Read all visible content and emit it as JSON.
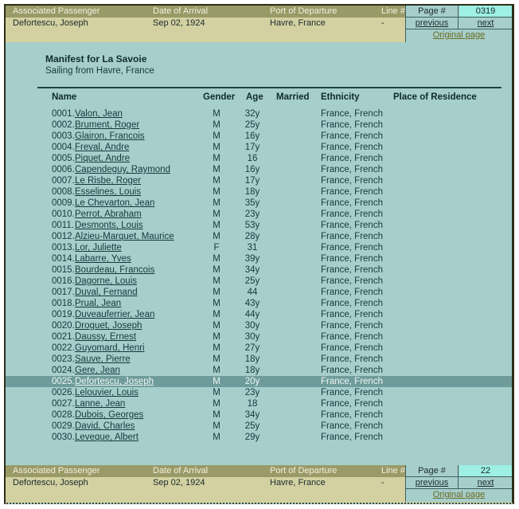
{
  "top_nav": {
    "headers": {
      "passenger": "Associated Passenger",
      "date": "Date of Arrival",
      "port": "Port of Departure",
      "line": "Line #"
    },
    "values": {
      "passenger": "Defortescu, Joseph",
      "date": "Sep 02, 1924",
      "port": "Havre, France",
      "line": "-"
    },
    "page_label": "Page #",
    "page_value": "0319",
    "previous_label": "previous",
    "next_label": "next",
    "original_page_label": "Original page"
  },
  "bottom_nav": {
    "headers": {
      "passenger": "Associated Passenger",
      "date": "Date of Arrival",
      "port": "Port of Departure",
      "line": "Line #"
    },
    "values": {
      "passenger": "Defortescu, Joseph",
      "date": "Sep 02, 1924",
      "port": "Havre, France",
      "line": "-"
    },
    "page_label": "Page #",
    "page_value": "22",
    "previous_label": "previous",
    "next_label": "next",
    "original_page_label": "Original page"
  },
  "manifest": {
    "title": "Manifest for La Savoie",
    "subtitle": "Sailing from Havre, France",
    "columns": {
      "name": "Name",
      "gender": "Gender",
      "age": "Age",
      "married": "Married",
      "ethnicity": "Ethnicity",
      "residence": "Place of Residence"
    },
    "selected_index": 24,
    "passengers": [
      {
        "idx": "0001.",
        "name": "Valon, Jean",
        "gender": "M",
        "age": "32y",
        "married": "",
        "ethnicity": "France, French",
        "residence": ""
      },
      {
        "idx": "0002.",
        "name": "Brument, Roger",
        "gender": "M",
        "age": "25y",
        "married": "",
        "ethnicity": "France, French",
        "residence": ""
      },
      {
        "idx": "0003.",
        "name": "Glairon, Francois",
        "gender": "M",
        "age": "16y",
        "married": "",
        "ethnicity": "France, French",
        "residence": ""
      },
      {
        "idx": "0004.",
        "name": "Freval, Andre",
        "gender": "M",
        "age": "17y",
        "married": "",
        "ethnicity": "France, French",
        "residence": ""
      },
      {
        "idx": "0005.",
        "name": "Piquet, Andre",
        "gender": "M",
        "age": "16",
        "married": "",
        "ethnicity": "France, French",
        "residence": ""
      },
      {
        "idx": "0006.",
        "name": "Capendeguy, Raymond",
        "gender": "M",
        "age": "16y",
        "married": "",
        "ethnicity": "France, French",
        "residence": ""
      },
      {
        "idx": "0007.",
        "name": "Le Risbe, Roger",
        "gender": "M",
        "age": "17y",
        "married": "",
        "ethnicity": "France, French",
        "residence": ""
      },
      {
        "idx": "0008.",
        "name": "Esselines, Louis",
        "gender": "M",
        "age": "18y",
        "married": "",
        "ethnicity": "France, French",
        "residence": ""
      },
      {
        "idx": "0009.",
        "name": "Le Chevarton, Jean",
        "gender": "M",
        "age": "35y",
        "married": "",
        "ethnicity": "France, French",
        "residence": ""
      },
      {
        "idx": "0010.",
        "name": "Perrot, Abraham",
        "gender": "M",
        "age": "23y",
        "married": "",
        "ethnicity": "France, French",
        "residence": ""
      },
      {
        "idx": "0011.",
        "name": "Desmonts, Louis",
        "gender": "M",
        "age": "53y",
        "married": "",
        "ethnicity": "France, French",
        "residence": ""
      },
      {
        "idx": "0012.",
        "name": "Alzieu-Marquet, Maurice",
        "gender": "M",
        "age": "28y",
        "married": "",
        "ethnicity": "France, French",
        "residence": ""
      },
      {
        "idx": "0013.",
        "name": "Lor, Juliette",
        "gender": "F",
        "age": "31",
        "married": "",
        "ethnicity": "France, French",
        "residence": ""
      },
      {
        "idx": "0014.",
        "name": "Labarre, Yves",
        "gender": "M",
        "age": "39y",
        "married": "",
        "ethnicity": "France, French",
        "residence": ""
      },
      {
        "idx": "0015.",
        "name": "Bourdeau, Francois",
        "gender": "M",
        "age": "34y",
        "married": "",
        "ethnicity": "France, French",
        "residence": ""
      },
      {
        "idx": "0016.",
        "name": "Dagorne, Louis",
        "gender": "M",
        "age": "25y",
        "married": "",
        "ethnicity": "France, French",
        "residence": ""
      },
      {
        "idx": "0017.",
        "name": "Duval, Fernand",
        "gender": "M",
        "age": "44",
        "married": "",
        "ethnicity": "France, French",
        "residence": ""
      },
      {
        "idx": "0018.",
        "name": "Prual, Jean",
        "gender": "M",
        "age": "43y",
        "married": "",
        "ethnicity": "France, French",
        "residence": ""
      },
      {
        "idx": "0019.",
        "name": "Duveauferrier, Jean",
        "gender": "M",
        "age": "44y",
        "married": "",
        "ethnicity": "France, French",
        "residence": ""
      },
      {
        "idx": "0020.",
        "name": "Droguet, Joseph",
        "gender": "M",
        "age": "30y",
        "married": "",
        "ethnicity": "France, French",
        "residence": ""
      },
      {
        "idx": "0021.",
        "name": "Daussy, Ernest",
        "gender": "M",
        "age": "30y",
        "married": "",
        "ethnicity": "France, French",
        "residence": ""
      },
      {
        "idx": "0022.",
        "name": "Guyomard, Henri",
        "gender": "M",
        "age": "27y",
        "married": "",
        "ethnicity": "France, French",
        "residence": ""
      },
      {
        "idx": "0023.",
        "name": "Sauve, Pierre",
        "gender": "M",
        "age": "18y",
        "married": "",
        "ethnicity": "France, French",
        "residence": ""
      },
      {
        "idx": "0024.",
        "name": "Gere, Jean",
        "gender": "M",
        "age": "18y",
        "married": "",
        "ethnicity": "France, French",
        "residence": ""
      },
      {
        "idx": "0025.",
        "name": "Defortescu, Joseph",
        "gender": "M",
        "age": "20y",
        "married": "",
        "ethnicity": "France, French",
        "residence": ""
      },
      {
        "idx": "0026.",
        "name": "Lelouvier, Louis",
        "gender": "M",
        "age": "23y",
        "married": "",
        "ethnicity": "France, French",
        "residence": ""
      },
      {
        "idx": "0027.",
        "name": "Lanne, Jean",
        "gender": "M",
        "age": "18",
        "married": "",
        "ethnicity": "France, French",
        "residence": ""
      },
      {
        "idx": "0028.",
        "name": "Dubois, Georges",
        "gender": "M",
        "age": "34y",
        "married": "",
        "ethnicity": "France, French",
        "residence": ""
      },
      {
        "idx": "0029.",
        "name": "David, Charles",
        "gender": "M",
        "age": "25y",
        "married": "",
        "ethnicity": "France, French",
        "residence": ""
      },
      {
        "idx": "0030.",
        "name": "Leveque, Albert",
        "gender": "M",
        "age": "29y",
        "married": "",
        "ethnicity": "France, French",
        "residence": ""
      }
    ]
  },
  "colors": {
    "page_background": "#ffffff",
    "frame_border": "#2d2d18",
    "manifest_background": "#a6cfcc",
    "navbar_header": "#9a9a68",
    "navbar_value": "#d3d1a2",
    "highlight_cyan": "#9df0e3",
    "selected_row": "#6f9c9b",
    "link_olive": "#6c6a20"
  }
}
